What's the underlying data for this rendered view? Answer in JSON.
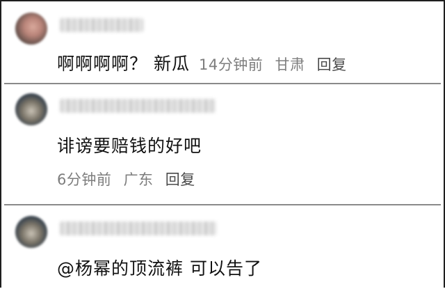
{
  "comments": [
    {
      "text": "啊啊啊啊？ 新瓜",
      "time": "14分钟前",
      "location": "甘肃",
      "reply_label": "回复"
    },
    {
      "text": "诽谤要赔钱的好吧",
      "time": "6分钟前",
      "location": "广东",
      "reply_label": "回复"
    },
    {
      "text": "@杨幂的顶流裤  可以告了"
    }
  ]
}
